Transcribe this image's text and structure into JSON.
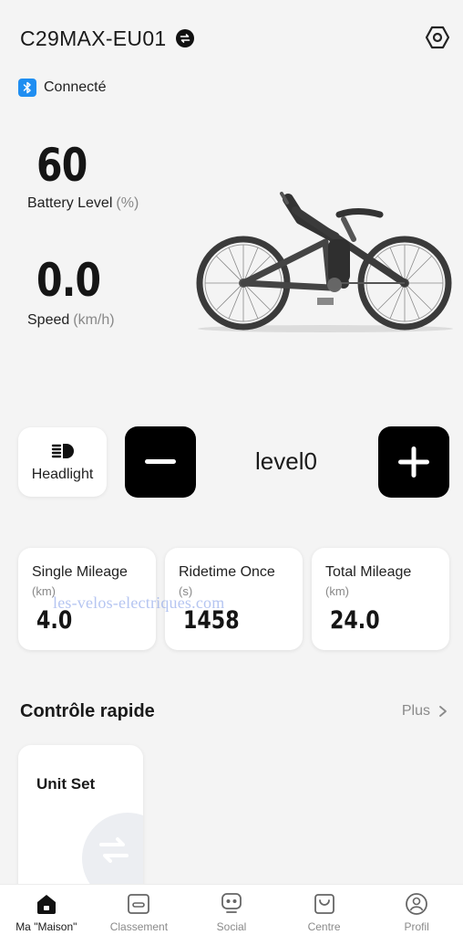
{
  "header": {
    "device_name": "C29MAX-EU01",
    "connection_status": "Connecté"
  },
  "metrics": {
    "battery_value": "60",
    "battery_label": "Battery Level",
    "battery_unit": "(%)",
    "speed_value": "0.0",
    "speed_label": "Speed",
    "speed_unit": "(km/h)"
  },
  "controls": {
    "headlight_label": "Headlight",
    "assist_level": "level0"
  },
  "stats": [
    {
      "title": "Single Mileage",
      "unit": "(km)",
      "value": "4.0"
    },
    {
      "title": "Ridetime Once",
      "unit": "(s)",
      "value": "1458"
    },
    {
      "title": "Total Mileage",
      "unit": "(km)",
      "value": "24.0"
    }
  ],
  "watermark": "les-velos-electriques.com",
  "quick_control": {
    "title": "Contrôle rapide",
    "more_label": "Plus",
    "cards": [
      {
        "title": "Unit Set"
      }
    ]
  },
  "nav": {
    "items": [
      {
        "label": "Ma \"Maison\"",
        "icon": "home-icon",
        "active": true
      },
      {
        "label": "Classement",
        "icon": "ranking-icon",
        "active": false
      },
      {
        "label": "Social",
        "icon": "social-icon",
        "active": false
      },
      {
        "label": "Centre",
        "icon": "shopping-bag-icon",
        "active": false
      },
      {
        "label": "Profil",
        "icon": "profile-icon",
        "active": false
      }
    ]
  },
  "colors": {
    "background": "#f4f4f4",
    "bluetooth": "#1f8ef1",
    "button_dark": "#000000",
    "card": "#ffffff"
  }
}
